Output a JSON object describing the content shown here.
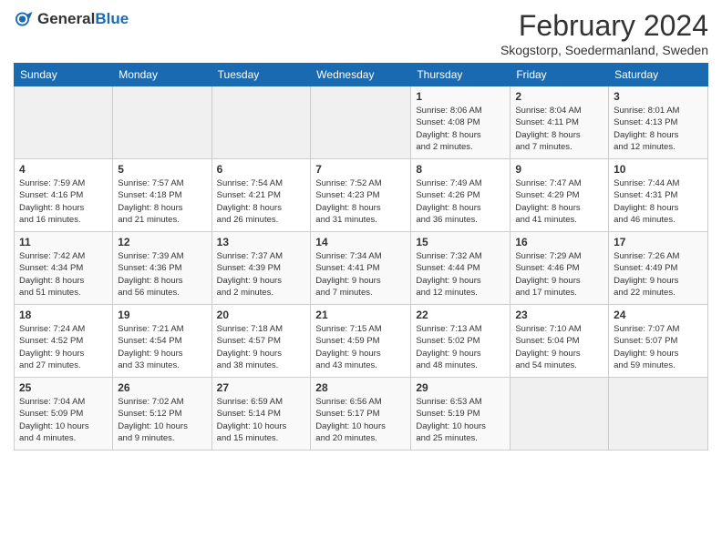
{
  "header": {
    "logo_general": "General",
    "logo_blue": "Blue",
    "month_year": "February 2024",
    "location": "Skogstorp, Soedermanland, Sweden"
  },
  "weekdays": [
    "Sunday",
    "Monday",
    "Tuesday",
    "Wednesday",
    "Thursday",
    "Friday",
    "Saturday"
  ],
  "weeks": [
    [
      {
        "day": "",
        "detail": ""
      },
      {
        "day": "",
        "detail": ""
      },
      {
        "day": "",
        "detail": ""
      },
      {
        "day": "",
        "detail": ""
      },
      {
        "day": "1",
        "detail": "Sunrise: 8:06 AM\nSunset: 4:08 PM\nDaylight: 8 hours\nand 2 minutes."
      },
      {
        "day": "2",
        "detail": "Sunrise: 8:04 AM\nSunset: 4:11 PM\nDaylight: 8 hours\nand 7 minutes."
      },
      {
        "day": "3",
        "detail": "Sunrise: 8:01 AM\nSunset: 4:13 PM\nDaylight: 8 hours\nand 12 minutes."
      }
    ],
    [
      {
        "day": "4",
        "detail": "Sunrise: 7:59 AM\nSunset: 4:16 PM\nDaylight: 8 hours\nand 16 minutes."
      },
      {
        "day": "5",
        "detail": "Sunrise: 7:57 AM\nSunset: 4:18 PM\nDaylight: 8 hours\nand 21 minutes."
      },
      {
        "day": "6",
        "detail": "Sunrise: 7:54 AM\nSunset: 4:21 PM\nDaylight: 8 hours\nand 26 minutes."
      },
      {
        "day": "7",
        "detail": "Sunrise: 7:52 AM\nSunset: 4:23 PM\nDaylight: 8 hours\nand 31 minutes."
      },
      {
        "day": "8",
        "detail": "Sunrise: 7:49 AM\nSunset: 4:26 PM\nDaylight: 8 hours\nand 36 minutes."
      },
      {
        "day": "9",
        "detail": "Sunrise: 7:47 AM\nSunset: 4:29 PM\nDaylight: 8 hours\nand 41 minutes."
      },
      {
        "day": "10",
        "detail": "Sunrise: 7:44 AM\nSunset: 4:31 PM\nDaylight: 8 hours\nand 46 minutes."
      }
    ],
    [
      {
        "day": "11",
        "detail": "Sunrise: 7:42 AM\nSunset: 4:34 PM\nDaylight: 8 hours\nand 51 minutes."
      },
      {
        "day": "12",
        "detail": "Sunrise: 7:39 AM\nSunset: 4:36 PM\nDaylight: 8 hours\nand 56 minutes."
      },
      {
        "day": "13",
        "detail": "Sunrise: 7:37 AM\nSunset: 4:39 PM\nDaylight: 9 hours\nand 2 minutes."
      },
      {
        "day": "14",
        "detail": "Sunrise: 7:34 AM\nSunset: 4:41 PM\nDaylight: 9 hours\nand 7 minutes."
      },
      {
        "day": "15",
        "detail": "Sunrise: 7:32 AM\nSunset: 4:44 PM\nDaylight: 9 hours\nand 12 minutes."
      },
      {
        "day": "16",
        "detail": "Sunrise: 7:29 AM\nSunset: 4:46 PM\nDaylight: 9 hours\nand 17 minutes."
      },
      {
        "day": "17",
        "detail": "Sunrise: 7:26 AM\nSunset: 4:49 PM\nDaylight: 9 hours\nand 22 minutes."
      }
    ],
    [
      {
        "day": "18",
        "detail": "Sunrise: 7:24 AM\nSunset: 4:52 PM\nDaylight: 9 hours\nand 27 minutes."
      },
      {
        "day": "19",
        "detail": "Sunrise: 7:21 AM\nSunset: 4:54 PM\nDaylight: 9 hours\nand 33 minutes."
      },
      {
        "day": "20",
        "detail": "Sunrise: 7:18 AM\nSunset: 4:57 PM\nDaylight: 9 hours\nand 38 minutes."
      },
      {
        "day": "21",
        "detail": "Sunrise: 7:15 AM\nSunset: 4:59 PM\nDaylight: 9 hours\nand 43 minutes."
      },
      {
        "day": "22",
        "detail": "Sunrise: 7:13 AM\nSunset: 5:02 PM\nDaylight: 9 hours\nand 48 minutes."
      },
      {
        "day": "23",
        "detail": "Sunrise: 7:10 AM\nSunset: 5:04 PM\nDaylight: 9 hours\nand 54 minutes."
      },
      {
        "day": "24",
        "detail": "Sunrise: 7:07 AM\nSunset: 5:07 PM\nDaylight: 9 hours\nand 59 minutes."
      }
    ],
    [
      {
        "day": "25",
        "detail": "Sunrise: 7:04 AM\nSunset: 5:09 PM\nDaylight: 10 hours\nand 4 minutes."
      },
      {
        "day": "26",
        "detail": "Sunrise: 7:02 AM\nSunset: 5:12 PM\nDaylight: 10 hours\nand 9 minutes."
      },
      {
        "day": "27",
        "detail": "Sunrise: 6:59 AM\nSunset: 5:14 PM\nDaylight: 10 hours\nand 15 minutes."
      },
      {
        "day": "28",
        "detail": "Sunrise: 6:56 AM\nSunset: 5:17 PM\nDaylight: 10 hours\nand 20 minutes."
      },
      {
        "day": "29",
        "detail": "Sunrise: 6:53 AM\nSunset: 5:19 PM\nDaylight: 10 hours\nand 25 minutes."
      },
      {
        "day": "",
        "detail": ""
      },
      {
        "day": "",
        "detail": ""
      }
    ]
  ]
}
